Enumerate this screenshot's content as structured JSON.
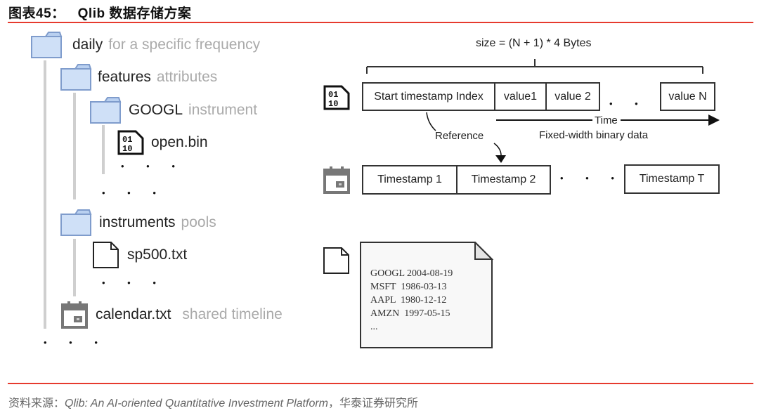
{
  "header": {
    "figure_label": "图表45：",
    "title": "Qlib 数据存储方案"
  },
  "tree": {
    "daily": {
      "name": "daily",
      "desc": "for a specific frequency",
      "icon": "folder-icon"
    },
    "features": {
      "name": "features",
      "desc": "attributes",
      "icon": "folder-icon"
    },
    "googl": {
      "name": "GOOGL",
      "desc": "instrument",
      "icon": "folder-icon"
    },
    "open_bin": {
      "name": "open.bin",
      "icon": "binary-file-icon"
    },
    "instruments": {
      "name": "instruments",
      "desc": "pools",
      "icon": "folder-icon"
    },
    "sp500": {
      "name": "sp500.txt",
      "icon": "text-file-icon"
    },
    "calendar": {
      "name": "calendar.txt",
      "desc": "shared timeline",
      "icon": "calendar-icon"
    },
    "ellipsis": "• • •"
  },
  "binary_layout": {
    "size_label": "size = (N + 1) * 4 Bytes",
    "cells": [
      "Start timestamp Index",
      "value1",
      "value 2",
      "value N"
    ],
    "ellipsis": "• • •",
    "time_label": "Time",
    "fixed_width_label": "Fixed-width binary data",
    "reference_label": "Reference"
  },
  "calendar_layout": {
    "cells": [
      "Timestamp 1",
      "Timestamp 2",
      "Timestamp T"
    ],
    "ellipsis": "• • •"
  },
  "instruments_file": {
    "lines": [
      "GOOGL 2004-08-19",
      "MSFT  1986-03-13",
      "AAPL  1980-12-12",
      "AMZN  1997-05-15",
      "..."
    ]
  },
  "colors": {
    "accent_rule": "#e63a2e",
    "folder_fill": "#cfe0f7",
    "folder_stroke": "#7f9ccc",
    "tree_line": "#cfcfcf"
  },
  "footer": {
    "source_prefix": "资料来源：",
    "source_title": "Qlib: An AI-oriented Quantitative Investment Platform",
    "source_suffix": "，华泰证券研究所"
  }
}
